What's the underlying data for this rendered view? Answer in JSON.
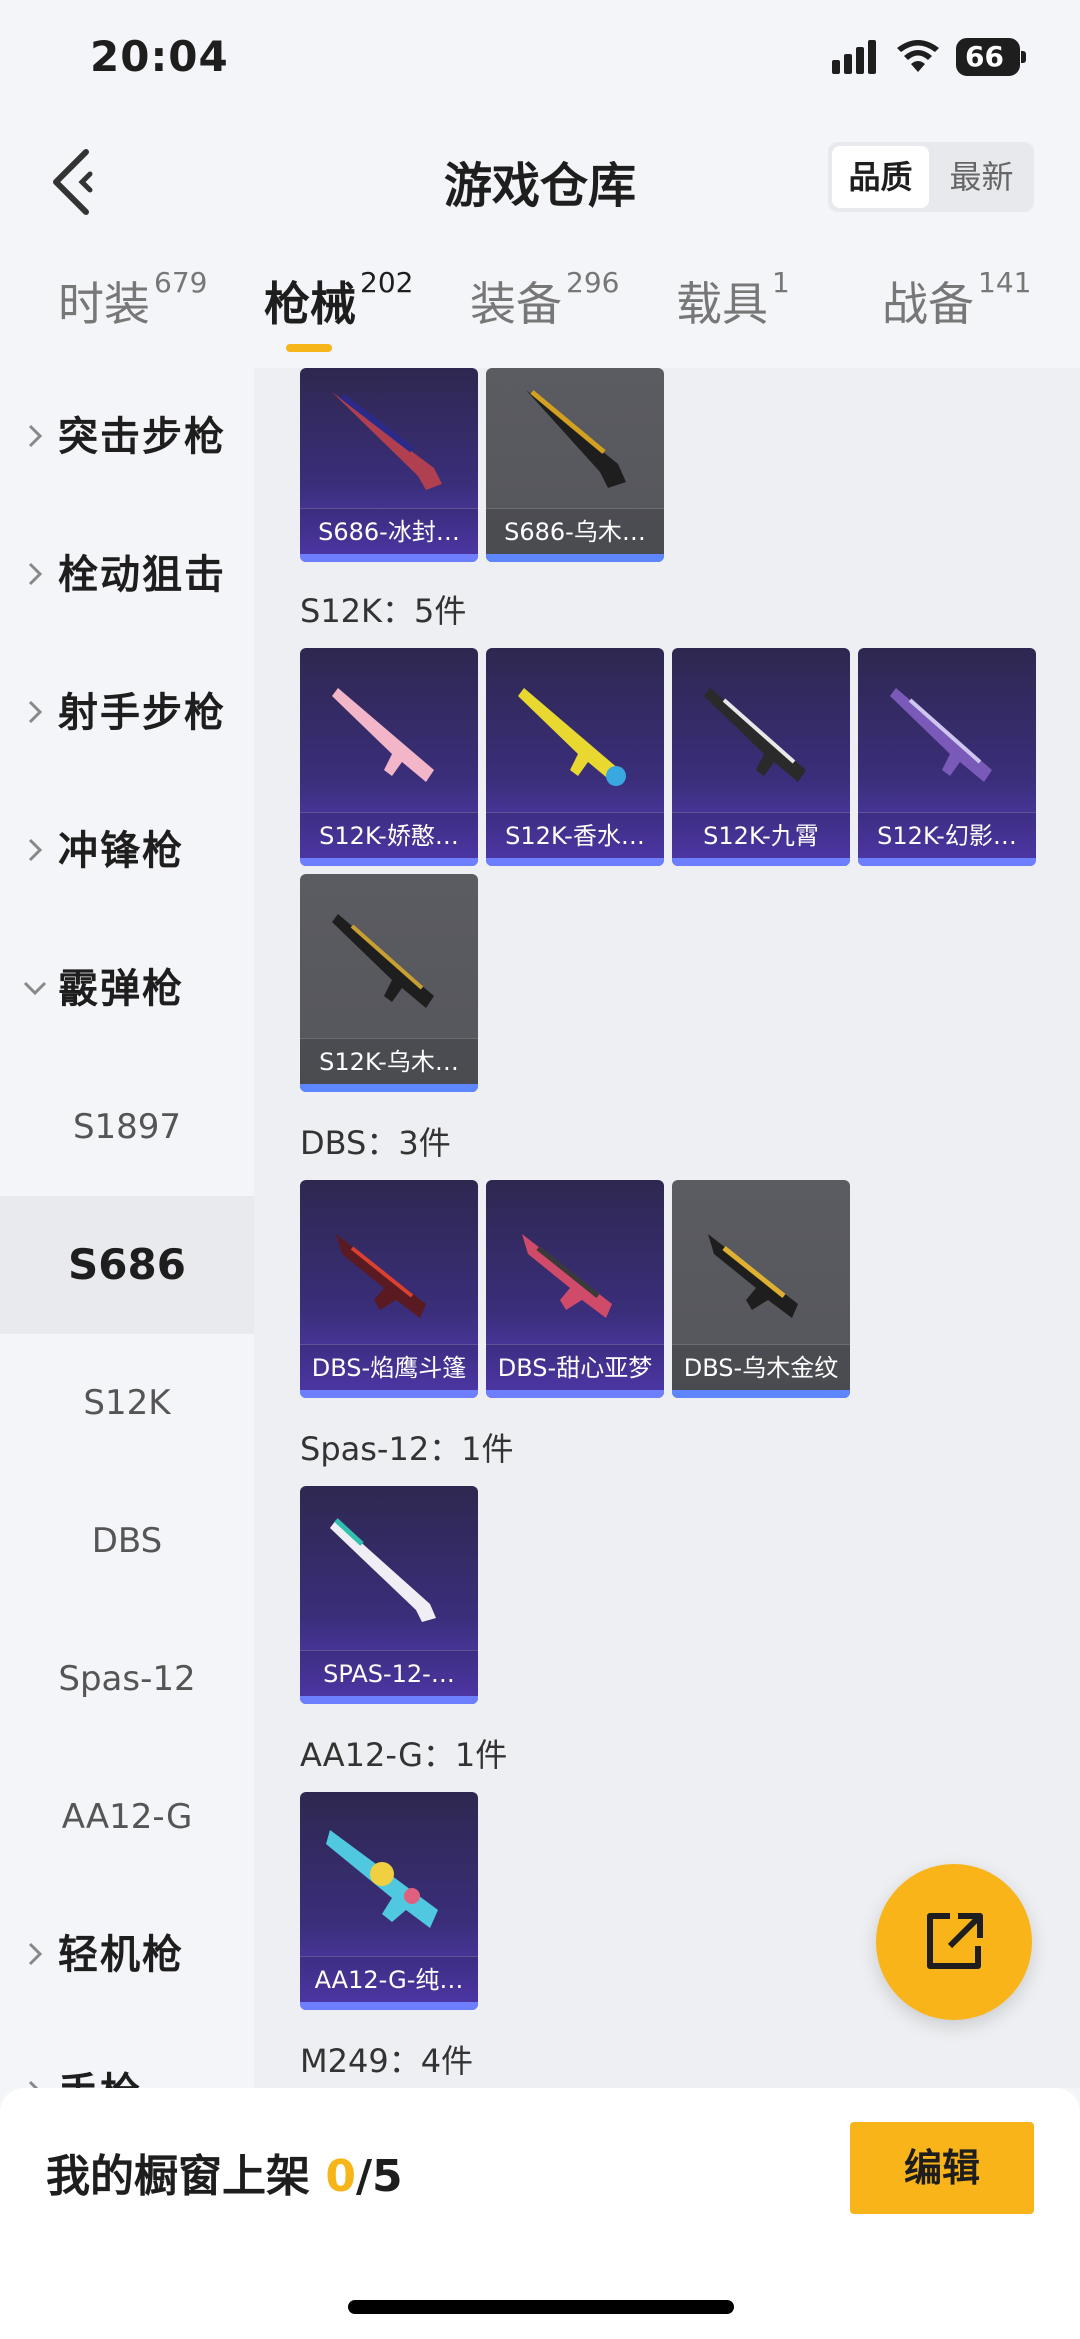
{
  "status": {
    "time": "20:04",
    "battery": "66"
  },
  "header": {
    "title": "游戏仓库",
    "sort": {
      "selected": "品质",
      "other": "最新"
    }
  },
  "tabs": [
    {
      "label": "时装",
      "count": "679"
    },
    {
      "label": "枪械",
      "count": "202"
    },
    {
      "label": "装备",
      "count": "296"
    },
    {
      "label": "载具",
      "count": "1"
    },
    {
      "label": "战备",
      "count": "141"
    }
  ],
  "sidebar": {
    "categories": {
      "assault": "突击步枪",
      "bolt": "栓动狙击",
      "dmr": "射手步枪",
      "smg": "冲锋枪",
      "shotgun": "霰弹枪",
      "lmg": "轻机枪",
      "pistol": "手枪"
    },
    "shotgun_items": [
      "S1897",
      "S686",
      "S12K",
      "DBS",
      "Spas-12",
      "AA12-G"
    ]
  },
  "content": {
    "s686": [
      "S686-冰封…",
      "S686-乌木…"
    ],
    "s12k": {
      "heading": "S12K：5件",
      "items": [
        "S12K-娇憨…",
        "S12K-香水…",
        "S12K-九霄",
        "S12K-幻影…",
        "S12K-乌木…"
      ]
    },
    "dbs": {
      "heading": "DBS：3件",
      "items": [
        "DBS-焰鹰斗篷",
        "DBS-甜心亚梦",
        "DBS-乌木金纹"
      ]
    },
    "spas": {
      "heading": "Spas-12：1件",
      "items": [
        "SPAS-12-…"
      ]
    },
    "aa12": {
      "heading": "AA12-G：1件",
      "items": [
        "AA12-G-纯…"
      ]
    },
    "m249": {
      "heading": "M249：4件"
    }
  },
  "bottom": {
    "label": "我的橱窗上架",
    "current": "0",
    "total": "/5",
    "edit": "编辑"
  },
  "colors": {
    "accent": "#f8b418",
    "epic_card": "#3a2e7a",
    "gray_card": "#5b5c62",
    "rarity_bar": "#6d7fff"
  }
}
